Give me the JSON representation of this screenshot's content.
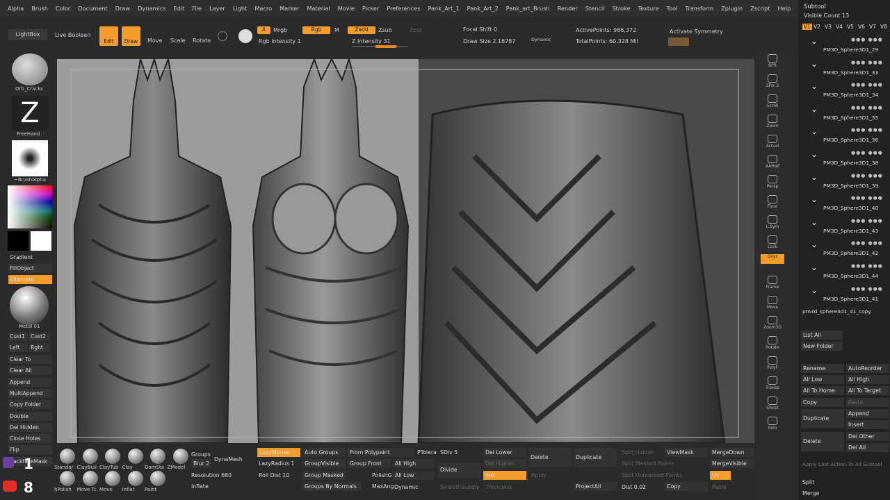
{
  "menu": [
    "Alpha",
    "Brush",
    "Color",
    "Document",
    "Draw",
    "Dynamics",
    "Edit",
    "File",
    "Layer",
    "Light",
    "Macro",
    "Marker",
    "Material",
    "Movie",
    "Picker",
    "Preferences",
    "Pank_Art_1",
    "Pank_Art_2",
    "Pank_art_Brush",
    "Render",
    "Stencil",
    "Stroke",
    "Texture",
    "Tool",
    "Transform",
    "Zplugin",
    "Zscript",
    "Help"
  ],
  "top": {
    "lightbox": "LightBox",
    "live_boolean": "Live Boolean",
    "edit": "Edit",
    "draw": "Draw",
    "move": "Move",
    "scale": "Scale",
    "rotate": "Rotate",
    "a": "A",
    "mrgb": "Mrgb",
    "rgb": "Rgb",
    "m": "M",
    "zadd": "Zadd",
    "zsub": "Zsub",
    "zcut": "Zcut",
    "rgb_intensity": "Rgb Intensity 1",
    "z_intensity": "Z Intensity 31",
    "focal_shift": "Focal Shift 0",
    "draw_size": "Draw Size 2.18787",
    "dynamic": "Dynamic",
    "active_points": "ActivePoints: 986,372",
    "total_points": "TotalPoints: 60.328 Mil",
    "activate_symmetry": "Activate Symmetry"
  },
  "left": {
    "brush1": "Orb_Cracks",
    "brush2": "FreeHand",
    "alpha": "~BrushAlpha",
    "gradient": "Gradient",
    "fillobject": "FillObject",
    "alternate": "Alternate",
    "material": "Metal 01",
    "cust1": "Cust1",
    "cust2": "Cust2",
    "left": "Left",
    "right": "Rght",
    "items": [
      "Clear To",
      "Clear All",
      "Append",
      "MultiAppend",
      "Copy Folder",
      "Double",
      "Del Hidden",
      "Close Holes",
      "Flip",
      "BackfaceMask"
    ]
  },
  "right": [
    {
      "label": "BPR"
    },
    {
      "label": "SPix 3"
    },
    {
      "label": "Scroll"
    },
    {
      "label": "Zoom"
    },
    {
      "label": "Actual"
    },
    {
      "label": "AAHalf"
    },
    {
      "label": "Persp"
    },
    {
      "label": "Floor"
    },
    {
      "label": "L.Sym"
    },
    {
      "label": "Lock"
    },
    {
      "label": "Qxyz"
    },
    {
      "label": "Frame"
    },
    {
      "label": "Move"
    },
    {
      "label": "Zoom3D"
    },
    {
      "label": "Rotate"
    },
    {
      "label": "PolyF"
    },
    {
      "label": "Transp"
    },
    {
      "label": "Ghost"
    },
    {
      "label": "Solo"
    }
  ],
  "subtool": {
    "title": "Subtool",
    "visible_count": "Visible Count 13",
    "tabs": [
      "V1",
      "V2",
      "V3",
      "V4",
      "V5",
      "V6",
      "V7",
      "V8"
    ],
    "items": [
      "PM3D_Sphere3D1_29",
      "PM3D_Sphere3D1_33",
      "PM3D_Sphere3D1_34",
      "PM3D_Sphere3D1_35",
      "PM3D_Sphere3D1_36",
      "PM3D_Sphere3D1_38",
      "PM3D_Sphere3D1_39",
      "PM3D_Sphere3D1_40",
      "PM3D_Sphere3D1_43",
      "PM3D_Sphere3D1_42",
      "PM3D_Sphere3D1_44",
      "PM3D_Sphere3D1_41",
      "pm3d_sphere3d1_41_copy"
    ],
    "list_all": "List All",
    "new_folder": "New Folder",
    "rename": "Rename",
    "autoreorder": "AutoReorder",
    "all_low": "All Low",
    "all_high": "All High",
    "all_to_home": "All To Home",
    "all_to_target": "All To Target",
    "copy": "Copy",
    "paste": "Paste",
    "duplicate": "Duplicate",
    "append": "Append",
    "insert": "Insert",
    "delete": "Delete",
    "del_other": "Del Other",
    "del_all": "Del All",
    "apply_last": "Apply Last Action To All Subtool",
    "split": "Split",
    "merge": "Merge"
  },
  "bottom": {
    "brushes": [
      "Standar",
      "ClayBuil",
      "ClayTub",
      "Clay",
      "DamSta",
      "ZModel",
      "hPolish",
      "Move Tc",
      "Move",
      "Inflat",
      "Paint"
    ],
    "groups": "Groups",
    "blur": "Blur 2",
    "dynamesh": "DynaMesh",
    "resolution": "Resolution 680",
    "inflate": "Inflate",
    "lazymouse": "LazyMouse",
    "lazyradius": "LazyRadius 1",
    "rolldist": "Roll Dist 10",
    "autogroups": "Auto Groups",
    "groupvisible": "GroupVisible",
    "groupmasked": "Group Masked",
    "groupsbynormals": "Groups By Normals",
    "frompolypaint": "From Polypaint",
    "groupfront": "Group Front",
    "polishg": "PolishG",
    "maxang": "MaxAng",
    "allhigh": "All High",
    "alllow": "All Low",
    "dynamic": "Dynamic",
    "ptolera": "PTolera",
    "sdiv": "SDiv 5",
    "divide": "Divide",
    "smoothsubdiv": "SmoothSubdiv",
    "dellower": "Del Lower",
    "delhigher": "Del Higher",
    "smt": "Smt",
    "apply": "Apply",
    "thickness": "Thickness",
    "delete": "Delete",
    "duplicate": "Duplicate",
    "projectall": "ProjectAll",
    "splithidden": "Split Hidden",
    "splitmasked": "Split Masked Points",
    "splitunmasked": "Split Unmasked Points",
    "dist": "Dist 0.02",
    "viewmask": "ViewMask",
    "copy": "Copy",
    "mergedown": "MergeDown",
    "mergevisible": "MergeVisible",
    "uv": "Uv",
    "paste": "Paste",
    "yt_left": "1",
    "yt_right": "8"
  }
}
